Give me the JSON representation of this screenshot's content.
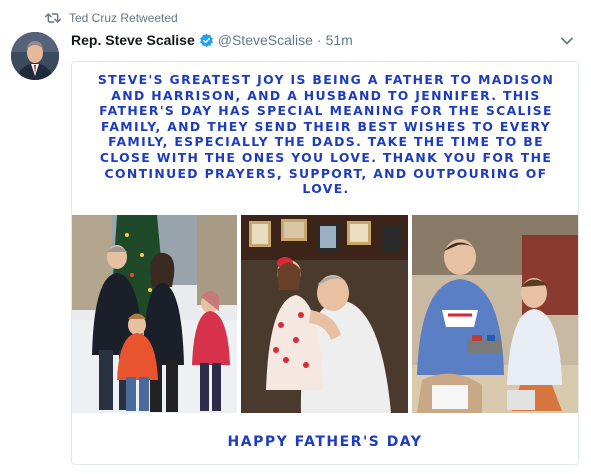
{
  "retweet": {
    "text": "Ted Cruz Retweeted",
    "icon": "retweet-icon"
  },
  "tweet": {
    "display_name": "Rep. Steve Scalise",
    "verified": true,
    "handle": "@SteveScalise",
    "separator": "·",
    "time": "51m",
    "caret_icon": "chevron-down-icon"
  },
  "media": {
    "message": "STEVE'S GREATEST JOY IS BEING A FATHER TO MADISON AND HARRISON, AND A HUSBAND TO JENNIFER. THIS FATHER'S DAY HAS SPECIAL MEANING FOR THE SCALISE FAMILY, AND THEY SEND THEIR BEST WISHES TO EVERY FAMILY, ESPECIALLY THE DADS. TAKE THE TIME TO BE CLOSE WITH THE ONES YOU LOVE. THANK YOU FOR THE CONTINUED PRAYERS, SUPPORT, AND OUTPOURING OF LOVE.",
    "footer": "HAPPY FATHER'S DAY",
    "photo_count": 3
  },
  "colors": {
    "accent_blue": "#1d3dbe",
    "verified_blue": "#1da1f2",
    "secondary_text": "#657786",
    "primary_text": "#14171a",
    "border": "#e1e8ed"
  }
}
